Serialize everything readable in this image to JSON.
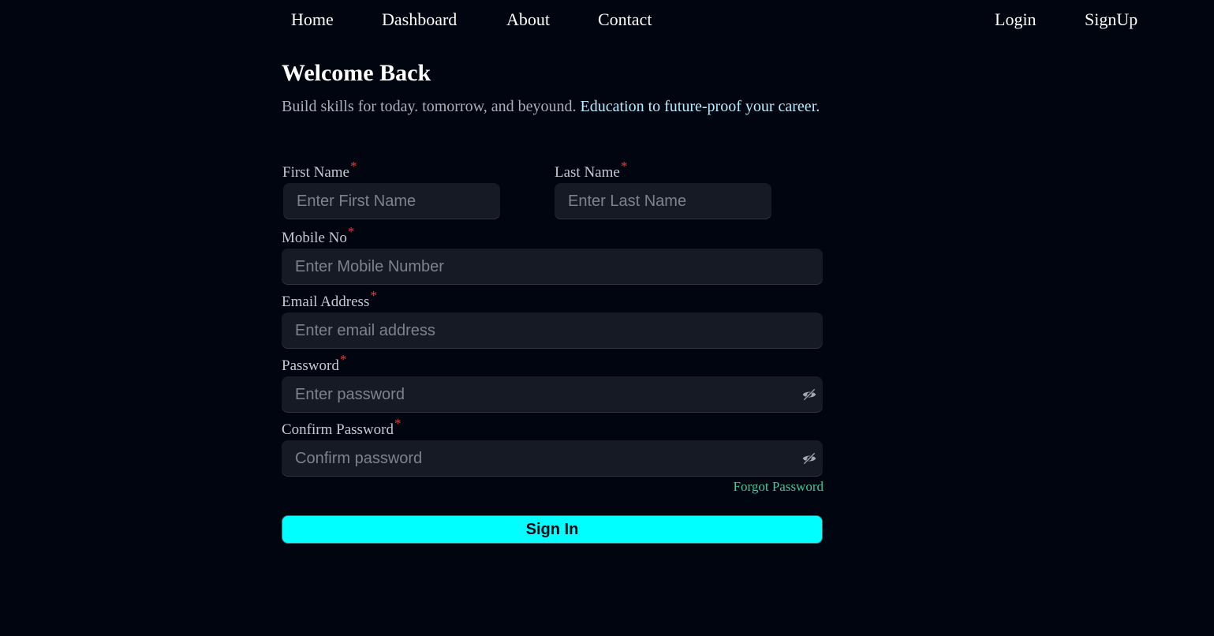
{
  "nav": {
    "left": [
      "Home",
      "Dashboard",
      "About",
      "Contact"
    ],
    "right": [
      "Login",
      "SignUp"
    ]
  },
  "header": {
    "title": "Welcome Back",
    "subtitle": "Build skills for today. tomorrow, and beyound.",
    "highlight": "Education to future-proof your career."
  },
  "form": {
    "required_mark": "*",
    "first_name": {
      "label": "First Name",
      "placeholder": "Enter First Name"
    },
    "last_name": {
      "label": "Last Name",
      "placeholder": "Enter Last Name"
    },
    "mobile": {
      "label": "Mobile No",
      "placeholder": "Enter Mobile Number"
    },
    "email": {
      "label": "Email Address",
      "placeholder": "Enter email address"
    },
    "password": {
      "label": "Password",
      "placeholder": "Enter password",
      "icon": "eye-icon"
    },
    "confirm_password": {
      "label": "Confirm Password",
      "placeholder": "Confirm password",
      "icon": "eye-icon"
    },
    "forgot_password": "Forgot Password",
    "submit": "Sign In"
  },
  "colors": {
    "background": "#000510",
    "field_background": "#161a25",
    "accent_button": "#00ffff",
    "highlight_text": "#b8ecff",
    "required": "#ef3b3b",
    "link": "#47c79a"
  }
}
